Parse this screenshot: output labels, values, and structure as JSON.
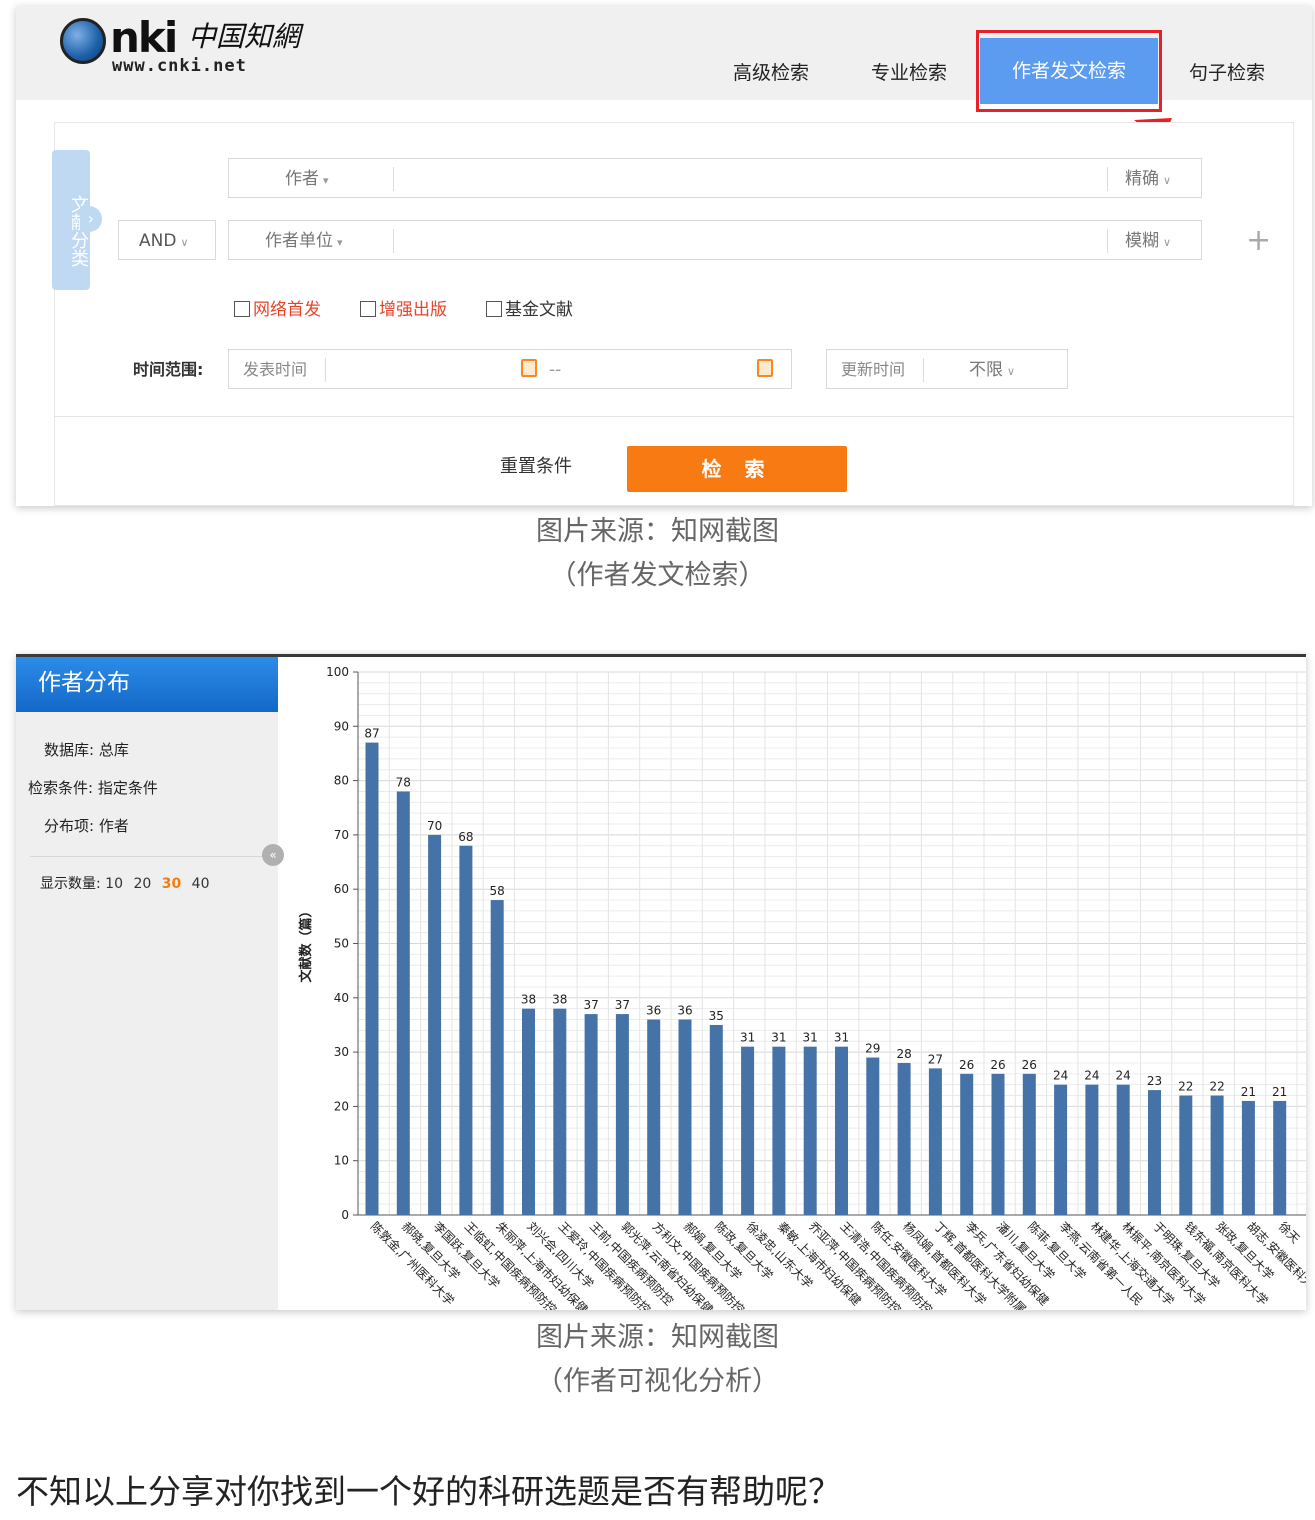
{
  "header": {
    "logo_main": "nki",
    "logo_cn": "中国知網",
    "logo_url": "www.cnki.net",
    "tabs": [
      "高级检索",
      "专业检索",
      "作者发文检索",
      "句子检索"
    ],
    "active_tab": "作者发文检索"
  },
  "search_form": {
    "side_tag": "文献分类",
    "row1": {
      "field": "作者",
      "match": "精确"
    },
    "row2": {
      "logic": "AND",
      "field": "作者单位",
      "match": "模糊"
    },
    "checkboxes": [
      "网络首发",
      "增强出版",
      "基金文献"
    ],
    "time_label": "时间范围:",
    "publish_time": "发表时间",
    "range_sep": "--",
    "update_time": "更新时间",
    "update_value": "不限",
    "reset_label": "重置条件",
    "search_label": "检 索"
  },
  "caption1": {
    "line1": "图片来源：知网截图",
    "line2": "（作者发文检索）"
  },
  "panel": {
    "title": "作者分布",
    "db_label": "数据库:",
    "db_value": "总库",
    "cond_label": "检索条件:",
    "cond_value": "指定条件",
    "dist_label": "分布项:",
    "dist_value": "作者",
    "show_label": "显示数量:",
    "counts": [
      "10",
      "20",
      "30",
      "40"
    ],
    "selected_count": "30"
  },
  "chart_data": {
    "type": "bar",
    "ylabel": "文献数（篇）",
    "ylim": [
      0,
      100
    ],
    "yticks": [
      0,
      10,
      20,
      30,
      40,
      50,
      60,
      70,
      80,
      90,
      100
    ],
    "grid": true,
    "bar_color": "#4572a7",
    "categories": [
      "陈敦金,广州医科大学",
      "郝晓,复旦大学",
      "李国跃,复旦大学",
      "王临虹,中国疾病预防控",
      "朱丽萍,上海市妇幼保健",
      "刘兴会,四川大学",
      "王爱玲,中国疾病预防控",
      "王前,中国疾病预防控",
      "郭光萍,云南省妇幼保健",
      "方利文,中国疾病预防控",
      "郝娟,复旦大学",
      "陈政,复旦大学",
      "徐凌忠,山东大学",
      "秦敏,上海市妇幼保健",
      "乔亚萍,中国疾病预防控",
      "王清浩,中国疾病预防控",
      "陈任,安徽医科大学",
      "杨凤娟,首都医科大学",
      "丁辉,首都医科大学附属",
      "李兵,广东省妇幼保健",
      "潘川,复旦大学",
      "陈菲,复旦大学",
      "李燕,云南省第一人民",
      "林建华,上海交通大学",
      "林振平,南京医科大学",
      "于明珠,复旦大学",
      "钱东福,南京医科大学",
      "张政,复旦大学",
      "胡志,安徽医科大学",
      "徐天"
    ],
    "values": [
      87,
      78,
      70,
      68,
      58,
      38,
      38,
      37,
      37,
      36,
      36,
      35,
      31,
      31,
      31,
      31,
      29,
      28,
      27,
      26,
      26,
      26,
      24,
      24,
      24,
      23,
      22,
      22,
      21,
      21
    ]
  },
  "caption2": {
    "line1": "图片来源：知网截图",
    "line2": "（作者可视化分析）"
  },
  "footer_text": "不知以上分享对你找到一个好的科研选题是否有帮助呢？"
}
